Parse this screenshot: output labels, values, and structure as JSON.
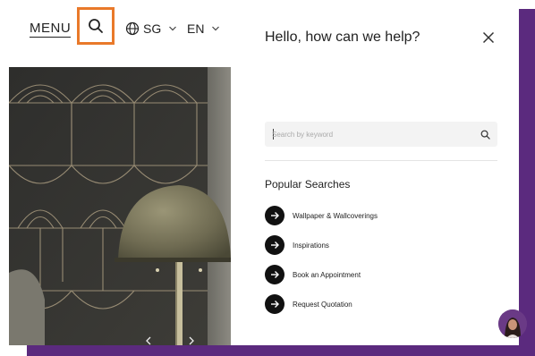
{
  "colors": {
    "accent_highlight": "#e9792a",
    "frame_purple": "#5b2a7e",
    "icon_dark": "#111111"
  },
  "header": {
    "menu_label": "MENU",
    "search_icon": "search-icon",
    "region_label": "SG",
    "language_label": "EN"
  },
  "panel": {
    "title": "Hello, how can we help?",
    "close_icon": "close-icon",
    "search": {
      "placeholder": "Search by keyword",
      "value": ""
    },
    "popular_title": "Popular Searches",
    "popular_items": [
      {
        "label": "Wallpaper & Wallcoverings",
        "icon": "arrow-right-icon"
      },
      {
        "label": "Inspirations",
        "icon": "arrow-right-icon"
      },
      {
        "label": "Book an Appointment",
        "icon": "arrow-right-icon"
      },
      {
        "label": "Request Quotation",
        "icon": "arrow-right-icon"
      }
    ]
  },
  "chat": {
    "icon": "chat-avatar-icon"
  }
}
